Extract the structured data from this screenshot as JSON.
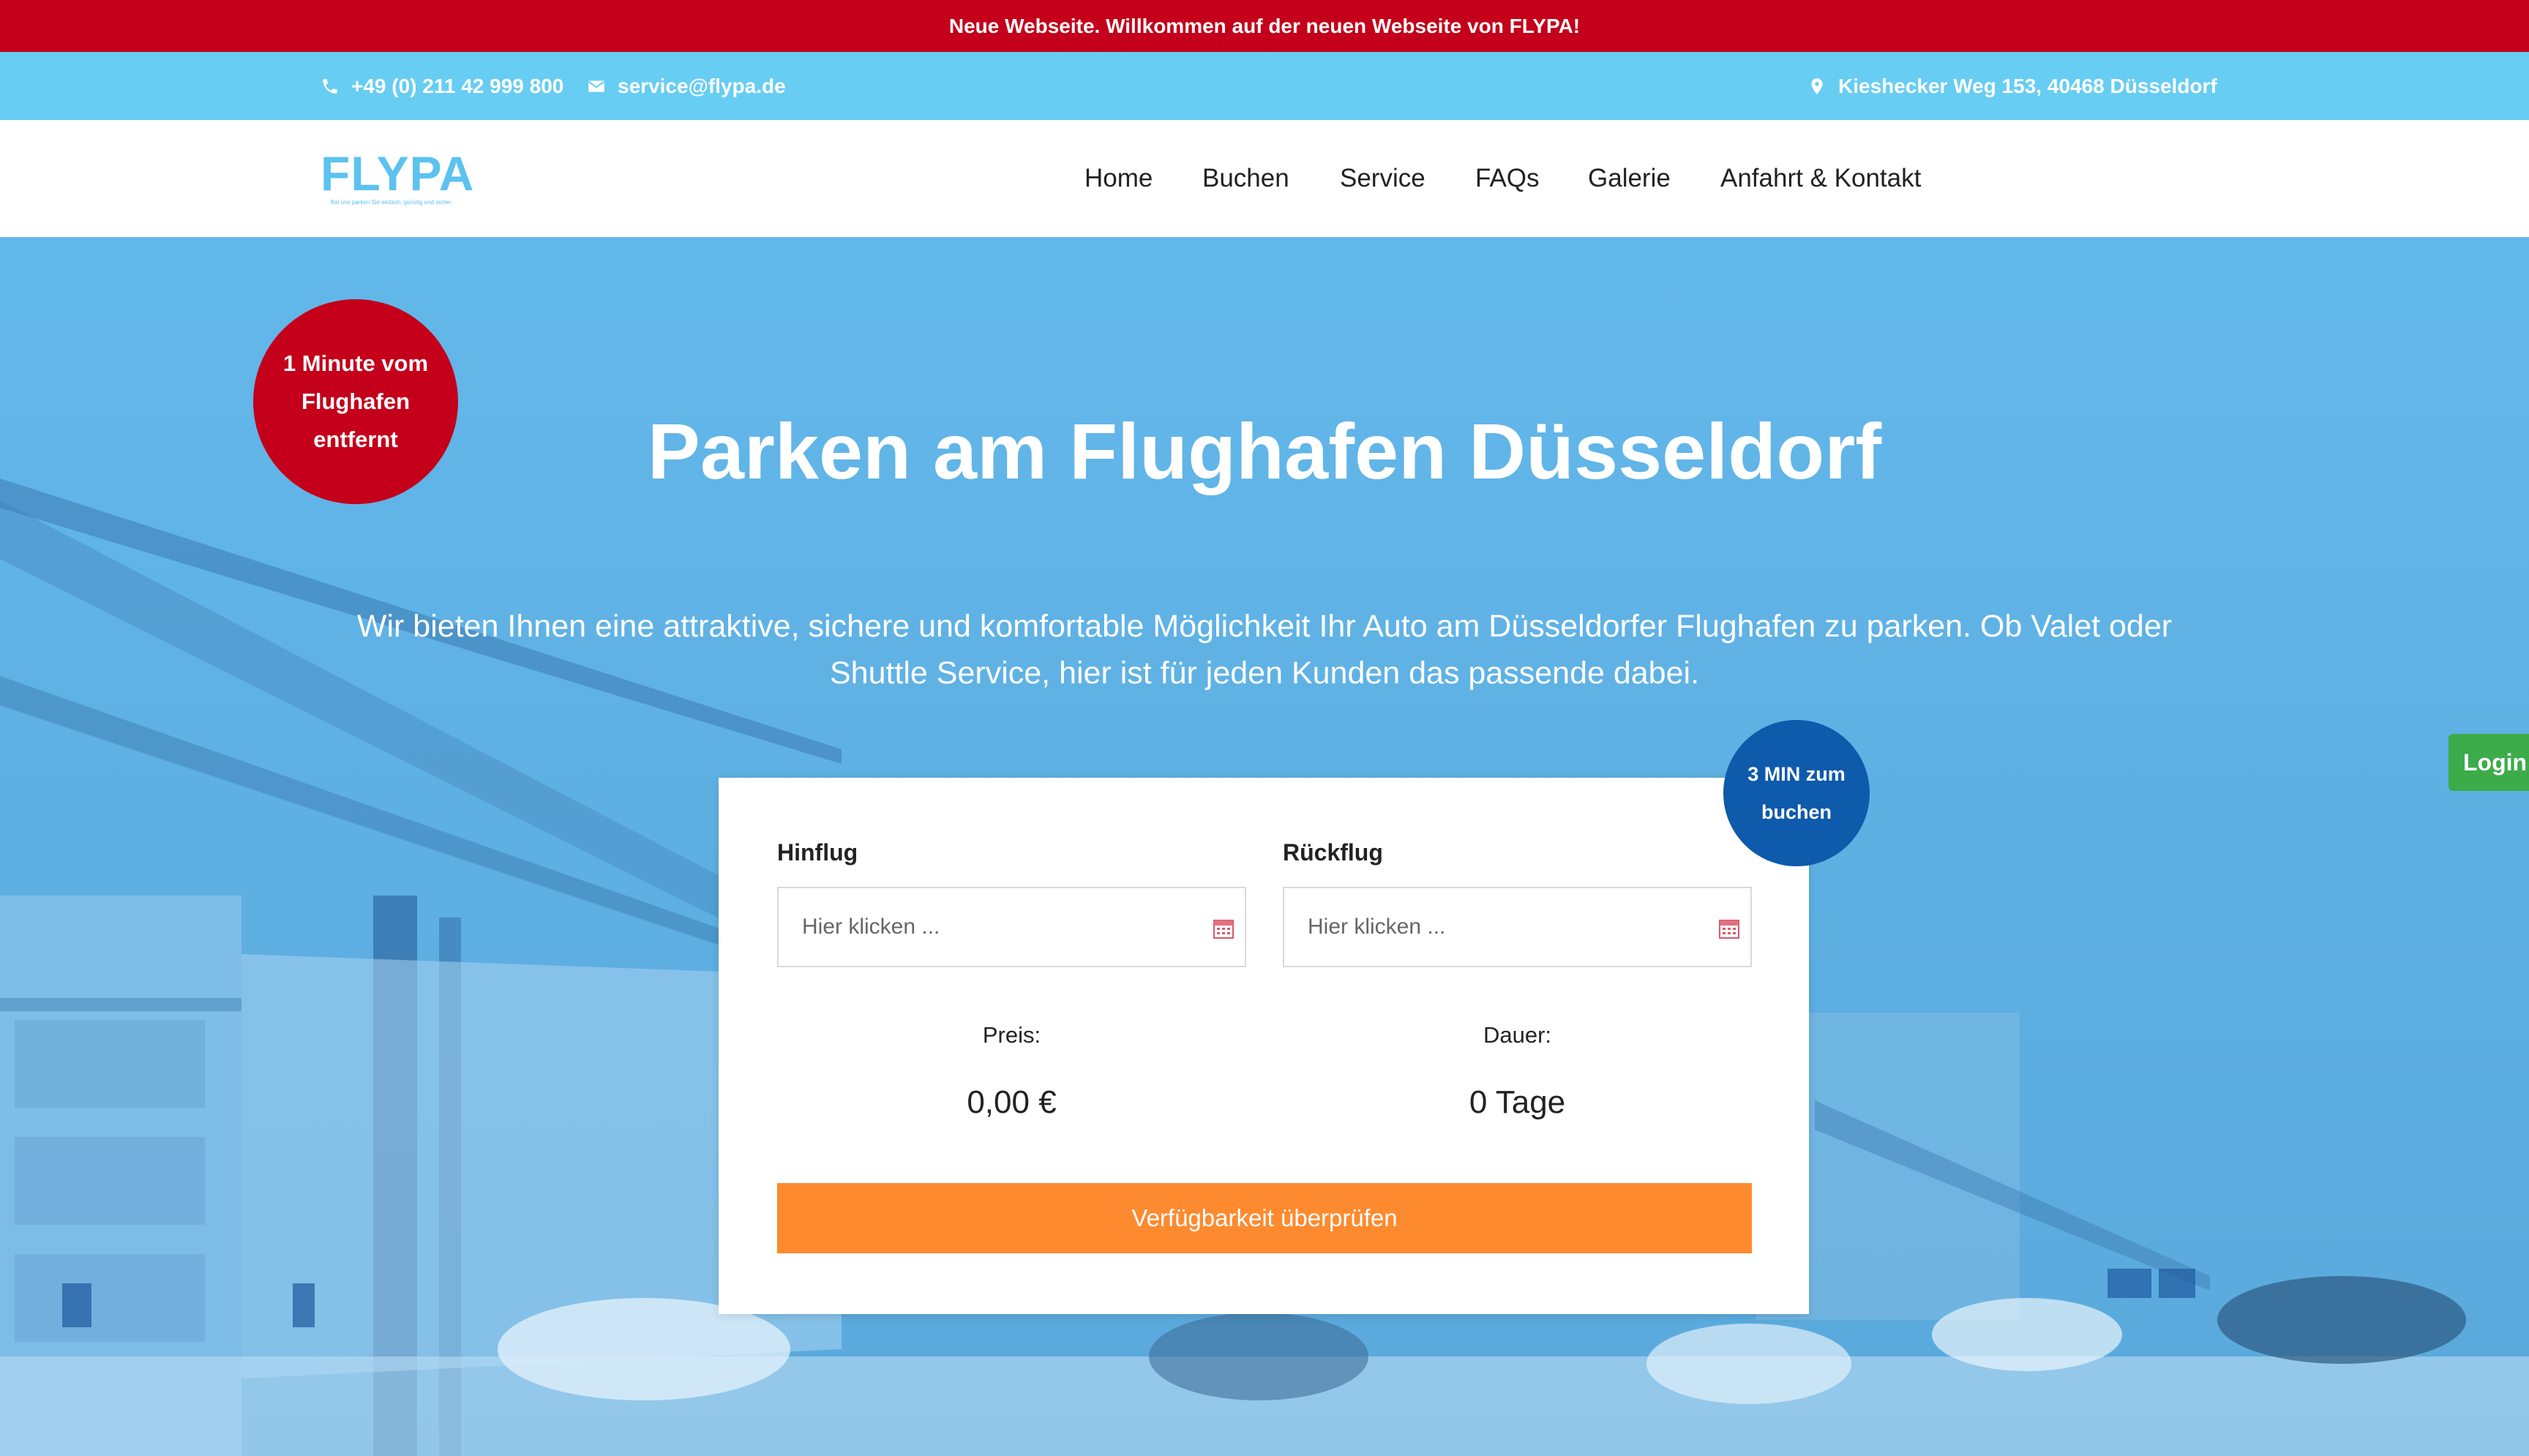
{
  "announcement": "Neue Webseite. Willkommen auf der neuen Webseite von FLYPA!",
  "contact": {
    "phone": "+49 (0) 211 42 999 800",
    "email": "service@flypa.de",
    "address": "Kieshecker Weg 153, 40468 Düsseldorf"
  },
  "brand": {
    "logo_text": "FLYPA",
    "logo_tagline": "Bei uns parken Sie einfach, günstig und sicher.",
    "accent": "#5cc2ef",
    "red": "#c4001a",
    "orange": "#fd8a2f",
    "green": "#3cab4a",
    "navy": "#0e5aab"
  },
  "nav": {
    "items": [
      "Home",
      "Buchen",
      "Service",
      "FAQs",
      "Galerie",
      "Anfahrt & Kontakt"
    ]
  },
  "hero": {
    "badge": "1 Minute vom Flughafen entfernt",
    "title": "Parken am Flughafen Düsseldorf",
    "subtitle": "Wir bieten Ihnen eine attraktive, sichere und komfortable Möglichkeit Ihr Auto am Düsseldorfer Flughafen zu parken. Ob Valet oder Shuttle Service, hier ist für jeden Kunden das passende dabei."
  },
  "booking": {
    "outbound_label": "Hinflug",
    "outbound_placeholder": "Hier klicken ...",
    "return_label": "Rückflug",
    "return_placeholder": "Hier klicken ...",
    "price_label": "Preis:",
    "price_value": "0,00 €",
    "duration_label": "Dauer:",
    "duration_value": "0 Tage",
    "submit_label": "Verfügbarkeit überprüfen",
    "badge": "3 MIN zum buchen"
  },
  "login_label": "Login"
}
